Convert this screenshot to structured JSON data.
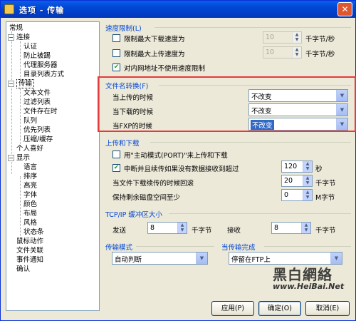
{
  "window": {
    "title": "选项 - 传输",
    "close_label": "✕"
  },
  "tree": {
    "items": [
      {
        "label": "常规"
      },
      {
        "label": "连接"
      },
      {
        "label": "认证"
      },
      {
        "label": "防止被踢"
      },
      {
        "label": "代理服务器"
      },
      {
        "label": "目录列表方式"
      },
      {
        "label": "传输"
      },
      {
        "label": "文本文件"
      },
      {
        "label": "过滤列表"
      },
      {
        "label": "文件存在时"
      },
      {
        "label": "队列"
      },
      {
        "label": "优先列表"
      },
      {
        "label": "压缩/缓存"
      },
      {
        "label": "个人喜好"
      },
      {
        "label": "显示"
      },
      {
        "label": "语言"
      },
      {
        "label": "排序"
      },
      {
        "label": "高亮"
      },
      {
        "label": "字体"
      },
      {
        "label": "颜色"
      },
      {
        "label": "布局"
      },
      {
        "label": "风格"
      },
      {
        "label": "状态条"
      },
      {
        "label": "鼠标动作"
      },
      {
        "label": "文件关联"
      },
      {
        "label": "事件通知"
      },
      {
        "label": "确认"
      }
    ]
  },
  "speed_limit": {
    "title": "速度限制(L)",
    "max_download": {
      "label": "限制最大下载速度为",
      "value": "10",
      "unit": "千字节/秒",
      "checked": false
    },
    "max_upload": {
      "label": "限制最大上传速度为",
      "value": "10",
      "unit": "千字节/秒",
      "checked": false
    },
    "local_no_limit": {
      "label": "对内网地址不使用速度限制",
      "checked": true
    }
  },
  "filename_conv": {
    "title": "文件名转换(F)",
    "upload": {
      "label": "当上传的时候",
      "value": "不改变"
    },
    "download": {
      "label": "当下载的时候",
      "value": "不改变"
    },
    "fxp": {
      "label": "当FXP的时候",
      "value": "不改变"
    }
  },
  "upload_download": {
    "title": "上传和下载",
    "pasv": {
      "label": "用\"主动模式(PORT)\"来上传和下载",
      "checked": false
    },
    "abort": {
      "label": "中断并且续传如果没有数据接收到超过",
      "value": "120",
      "unit": "秒",
      "checked": true
    },
    "retry": {
      "label": "当文件下载续传的时候回滚",
      "value": "20",
      "unit": "千字节"
    },
    "reserve": {
      "label": "保持剩余磁盘空间至少",
      "value": "0",
      "unit": "M字节"
    }
  },
  "tcp_buffer": {
    "title": "TCP/IP 缓冲区大小",
    "send": {
      "label": "发送",
      "value": "8",
      "unit": "千字节"
    },
    "recv": {
      "label": "接收",
      "value": "8",
      "unit": "千字节"
    }
  },
  "transfer_mode": {
    "title": "传输模式",
    "value": "自动判断"
  },
  "transfer_done": {
    "title": "当传输完成",
    "value": "停留在FTP上"
  },
  "buttons": {
    "apply": "应用(P)",
    "ok": "确定(O)",
    "cancel": "取消(E)"
  },
  "watermark": {
    "big": "黑白網絡",
    "url": "www.HeiBai.Net"
  },
  "colors": {
    "accent": "#0046d5",
    "highlight_box": "#e23c3c"
  }
}
